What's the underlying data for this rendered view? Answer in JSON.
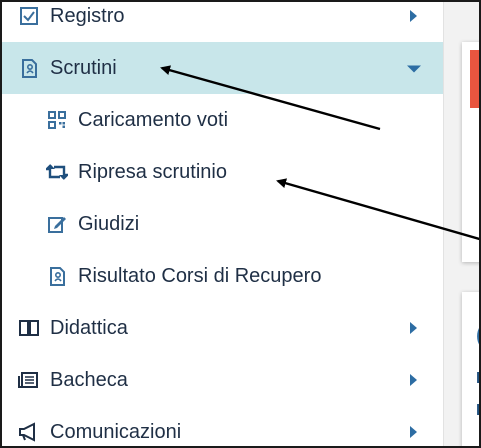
{
  "sidebar": {
    "items": [
      {
        "label": "Registro",
        "icon": "checkbox-icon"
      },
      {
        "label": "Scrutini",
        "icon": "clipboard-icon"
      },
      {
        "label": "Caricamento voti",
        "icon": "grid-icon"
      },
      {
        "label": "Ripresa scrutinio",
        "icon": "retweet-icon"
      },
      {
        "label": "Giudizi",
        "icon": "edit-icon"
      },
      {
        "label": "Risultato Corsi di Recupero",
        "icon": "clipboard-icon"
      },
      {
        "label": "Didattica",
        "icon": "book-icon"
      },
      {
        "label": "Bacheca",
        "icon": "newspaper-icon"
      },
      {
        "label": "Comunicazioni",
        "icon": "megaphone-icon"
      }
    ]
  },
  "content": {
    "card2_frag_top": "(",
    "card2_frag_1": "E",
    "card2_frag_2": "I"
  },
  "colors": {
    "accent": "#2d6da3",
    "active_bg": "#c8e6ea",
    "alert": "#e8553f",
    "text": "#1f2f45"
  }
}
